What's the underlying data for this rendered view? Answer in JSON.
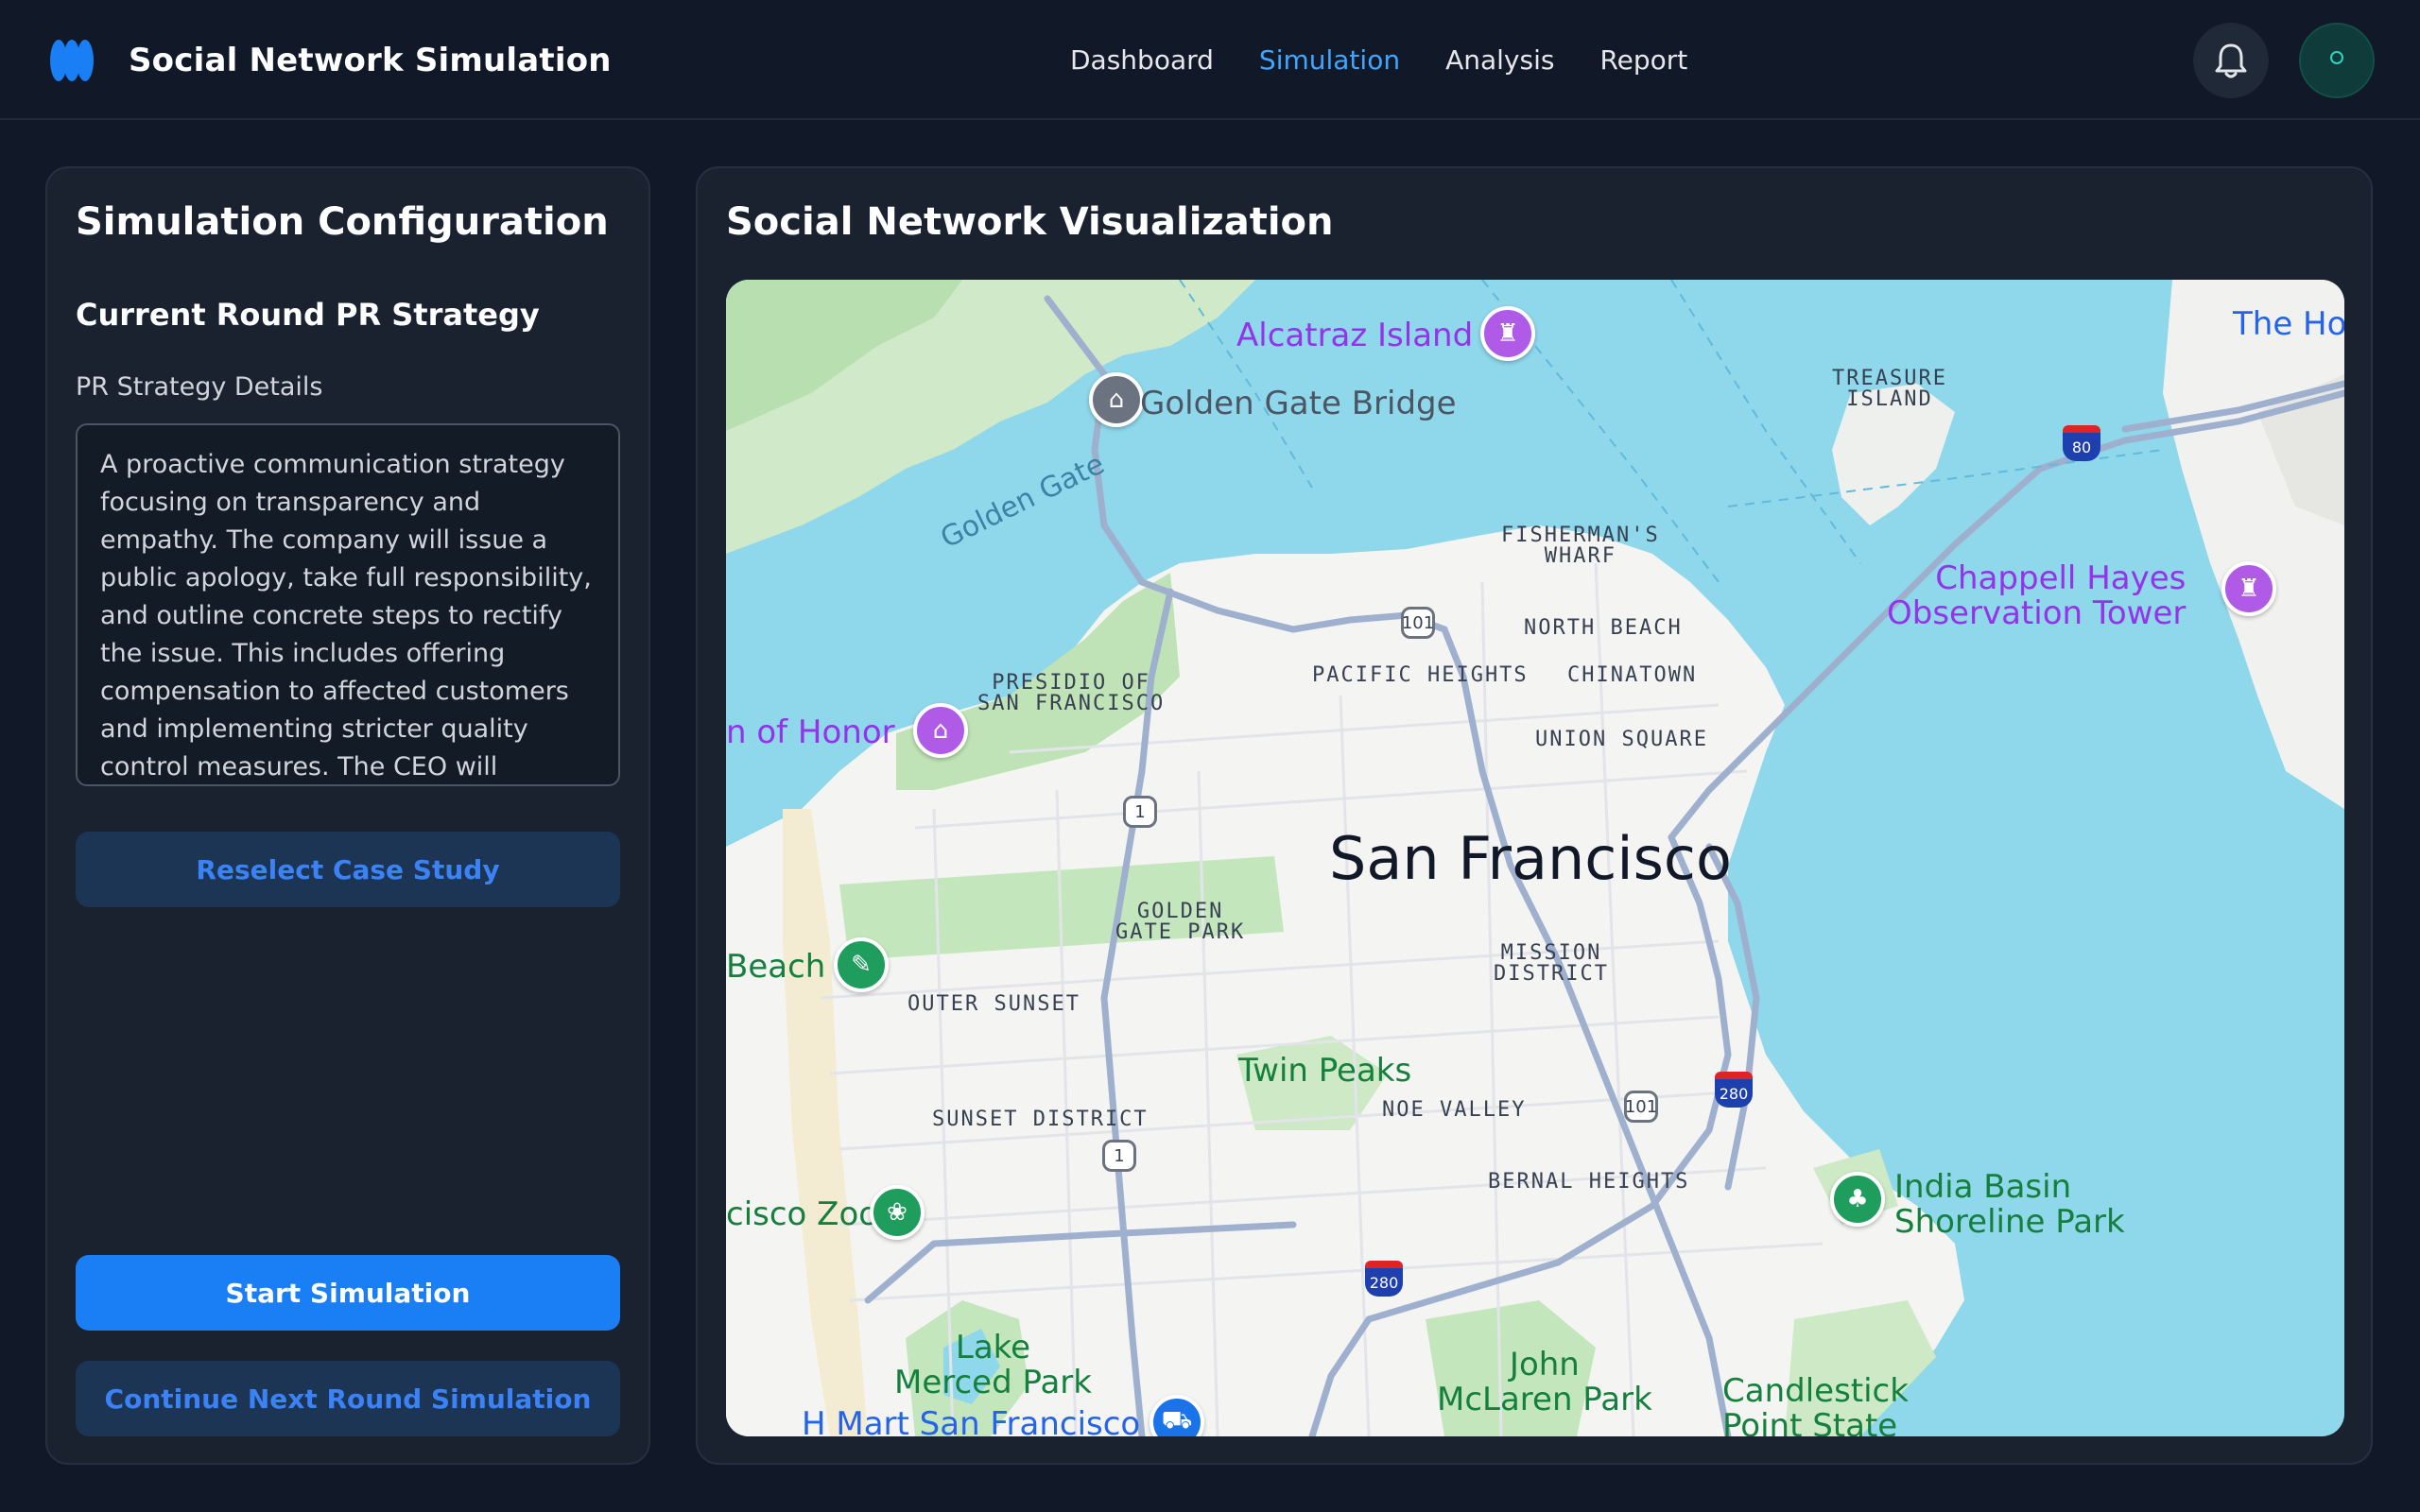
{
  "app": {
    "title": "Social Network Simulation"
  },
  "nav": {
    "items": [
      {
        "label": "Dashboard"
      },
      {
        "label": "Simulation",
        "active": true
      },
      {
        "label": "Analysis"
      },
      {
        "label": "Report"
      }
    ]
  },
  "header": {
    "icons": [
      "bell-icon",
      "avatar"
    ]
  },
  "config": {
    "title": "Simulation Configuration",
    "section_title": "Current Round PR Strategy",
    "field_label": "PR Strategy Details",
    "strategy_text": "A proactive communication strategy focusing on transparency and empathy. The company will issue a public apology, take full responsibility, and outline concrete steps to rectify the issue. This includes offering compensation to affected customers and implementing stricter quality control measures. The CEO will",
    "reselect_label": "Reselect Case Study",
    "start_label": "Start Simulation",
    "continue_label": "Continue Next Round Simulation"
  },
  "viz": {
    "title": "Social Network Visualization",
    "map": {
      "city": "San Francisco",
      "labels": {
        "alcatraz": "Alcatraz Island",
        "golden_gate_bridge": "Golden Gate Bridge",
        "golden_gate": "Golden Gate",
        "treasure_island": "TREASURE\nISLAND",
        "the_ho": "The Ho",
        "fishermans_wharf": "FISHERMAN'S\nWHARF",
        "north_beach": "NORTH BEACH",
        "pacific_heights": "PACIFIC HEIGHTS",
        "chinatown": "CHINATOWN",
        "presidio": "PRESIDIO OF\nSAN FRANCISCO",
        "legion_of_honor": "n of Honor",
        "union_square": "UNION SQUARE",
        "chappell_hayes": "Chappell Hayes\nObservation Tower",
        "golden_gate_park": "GOLDEN\nGATE PARK",
        "mission_district": "MISSION\nDISTRICT",
        "beach": "Beach",
        "outer_sunset": "OUTER SUNSET",
        "twin_peaks": "Twin Peaks",
        "noe_valley": "NOE VALLEY",
        "sunset_district": "SUNSET DISTRICT",
        "bernal_heights": "BERNAL HEIGHTS",
        "india_basin": "India Basin\nShoreline Park",
        "sf_zoo": "cisco Zoo",
        "lake_merced": "Lake\nMerced Park",
        "john_mclaren": "John\nMcLaren Park",
        "candlestick": "Candlestick\nPoint State",
        "hmart": "H Mart San Francisco",
        "hwy_101": "101",
        "hwy_1": "1",
        "i_80": "80",
        "i_280": "280"
      }
    }
  }
}
